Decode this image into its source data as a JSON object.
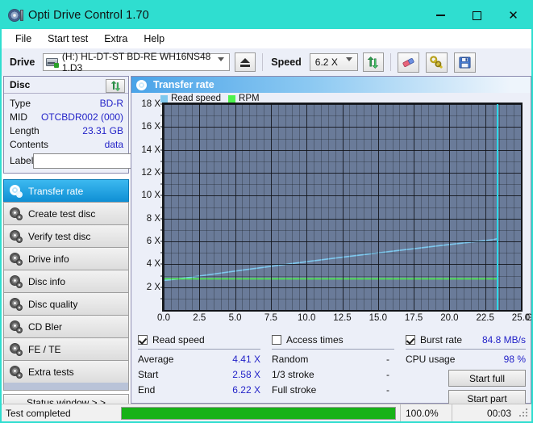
{
  "window": {
    "title": "Opti Drive Control 1.70",
    "icon": "optical-disc-icon",
    "titlebar_color": "#2fded0",
    "minimize": "—",
    "maximize": "☐",
    "close": "✕"
  },
  "menu": {
    "items": [
      "File",
      "Start test",
      "Extra",
      "Help"
    ]
  },
  "toolbar": {
    "drive_label": "Drive",
    "drive_value": "(H:)   HL-DT-ST BD-RE  WH16NS48 1.D3",
    "eject_title": "Eject",
    "speed_label": "Speed",
    "speed_value": "6.2 X",
    "refresh_title": "Refresh",
    "erase_title": "Erase",
    "tools_title": "Tools",
    "save_title": "Save"
  },
  "disc": {
    "header": "Disc",
    "refresh_title": "Refresh disc info",
    "rows": [
      {
        "label": "Type",
        "value": "BD-R"
      },
      {
        "label": "MID",
        "value": "OTCBDR002 (000)"
      },
      {
        "label": "Length",
        "value": "23.31 GB"
      },
      {
        "label": "Contents",
        "value": "data"
      }
    ],
    "label_caption": "Label",
    "label_value": "",
    "label_placeholder": ""
  },
  "nav": {
    "items": [
      {
        "label": "Transfer rate",
        "active": true
      },
      {
        "label": "Create test disc",
        "active": false
      },
      {
        "label": "Verify test disc",
        "active": false
      },
      {
        "label": "Drive info",
        "active": false
      },
      {
        "label": "Disc info",
        "active": false
      },
      {
        "label": "Disc quality",
        "active": false
      },
      {
        "label": "CD Bler",
        "active": false
      },
      {
        "label": "FE / TE",
        "active": false
      },
      {
        "label": "Extra tests",
        "active": false
      }
    ],
    "status_window": "Status window > >"
  },
  "panel": {
    "title": "Transfer rate"
  },
  "chart_data": {
    "type": "line",
    "title": "Transfer rate",
    "xlabel": "GB",
    "ylabel": "X",
    "x_unit": "GB",
    "xlim": [
      0.0,
      25.0
    ],
    "ylim": [
      0,
      18
    ],
    "xticks": [
      "0.0",
      "2.5",
      "5.0",
      "7.5",
      "10.0",
      "12.5",
      "15.0",
      "17.5",
      "20.0",
      "22.5",
      "25.0"
    ],
    "xtick_values": [
      0.0,
      2.5,
      5.0,
      7.5,
      10.0,
      12.5,
      15.0,
      17.5,
      20.0,
      22.5,
      25.0
    ],
    "yticks": [
      "18 X",
      "16 X",
      "14 X",
      "12 X",
      "10 X",
      "8 X",
      "6 X",
      "4 X",
      "2 X"
    ],
    "ytick_values": [
      18,
      16,
      14,
      12,
      10,
      8,
      6,
      4,
      2
    ],
    "grid": true,
    "legend_position": "top-left",
    "background": "#6a7b99",
    "series": [
      {
        "name": "Read speed",
        "color": "#7fc8ee",
        "x": [
          0.0,
          0.5,
          1.0,
          2.0,
          3.0,
          4.0,
          5.0,
          6.0,
          7.0,
          8.0,
          9.0,
          10.0,
          11.0,
          12.0,
          13.0,
          14.0,
          15.0,
          16.0,
          17.0,
          18.0,
          19.0,
          20.0,
          21.0,
          22.0,
          23.0,
          23.31
        ],
        "values": [
          2.58,
          2.64,
          2.72,
          2.88,
          3.06,
          3.23,
          3.4,
          3.57,
          3.73,
          3.9,
          4.06,
          4.22,
          4.38,
          4.54,
          4.69,
          4.84,
          4.99,
          5.14,
          5.29,
          5.43,
          5.58,
          5.72,
          5.86,
          6.0,
          6.14,
          6.22
        ]
      },
      {
        "name": "RPM",
        "color": "#4ef24e",
        "x": [
          0.0,
          23.31
        ],
        "values": [
          2.72,
          2.72
        ]
      }
    ],
    "cursor_x": 23.31
  },
  "legend": {
    "items": [
      {
        "label": "Read speed",
        "color": "#7fc8ee"
      },
      {
        "label": "RPM",
        "color": "#4ef24e"
      }
    ]
  },
  "stats": {
    "read_speed": {
      "header": "Read speed",
      "checked": true,
      "rows": [
        {
          "label": "Average",
          "value": "4.41 X"
        },
        {
          "label": "Start",
          "value": "2.58 X"
        },
        {
          "label": "End",
          "value": "6.22 X"
        }
      ]
    },
    "access_times": {
      "header": "Access times",
      "checked": false,
      "rows": [
        {
          "label": "Random",
          "value": "-"
        },
        {
          "label": "1/3 stroke",
          "value": "-"
        },
        {
          "label": "Full stroke",
          "value": "-"
        }
      ]
    },
    "burst": {
      "header": "Burst rate",
      "checked": true,
      "value": "84.8 MB/s",
      "cpu_label": "CPU usage",
      "cpu_value": "98 %",
      "start_full": "Start full",
      "start_part": "Start part"
    }
  },
  "statusbar": {
    "message": "Test completed",
    "progress_percent": 100.0,
    "progress_text": "100.0%",
    "elapsed": "00:03",
    "progress_color": "#17b217"
  }
}
